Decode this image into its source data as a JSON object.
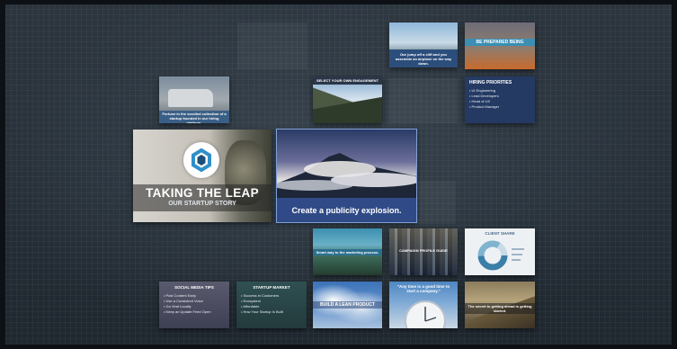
{
  "slides": {
    "main_title": "TAKING THE LEAP",
    "main_subtitle": "OUR STARTUP STORY",
    "feature_caption": "Create a publicity explosion.",
    "be_prepared": "BE PREPARED BEING",
    "wing_caption": "Our jump off a cliff and you assemble an airplane on the way down.",
    "van_caption": "Fortune in the scrolled collection of a startup founded in our hiring platform.",
    "mountain_header": "SELECT YOUR OWN ENGAGEMENT",
    "hiring_title": "HIRING PRIORITIES",
    "hiring_items": [
      "UI Engineering",
      "Lead Developers",
      "Head of UX",
      "Product Manager"
    ],
    "aerial_caption": "Smart way to the marketing process.",
    "lights_title": "CAMPAIGN PROFILE GUIDE",
    "chart_title": "CLIENT SHARE",
    "social_title": "SOCIAL MEDIA TIPS",
    "social_items": [
      "Post Content Early",
      "Use a Consistent Voice",
      "Go Viral Locally",
      "Keep an Update Feed Open"
    ],
    "market_title": "STARTUP MARKET",
    "market_items": [
      "Success in Customers",
      "Ecosystem",
      "Affordable",
      "How Your Startup Is Built"
    ],
    "build_caption": "BUILD A LEAN PRODUCT",
    "quote": "\"Any time is a good time to start a company.\"",
    "road_caption": "The secret to getting ahead is getting started."
  },
  "colors": {
    "accent_teal": "#3a8fb3",
    "navy": "#243a63",
    "feature_blue": "#2f4a86"
  },
  "icons": {
    "logo": "hexagon-icon"
  }
}
